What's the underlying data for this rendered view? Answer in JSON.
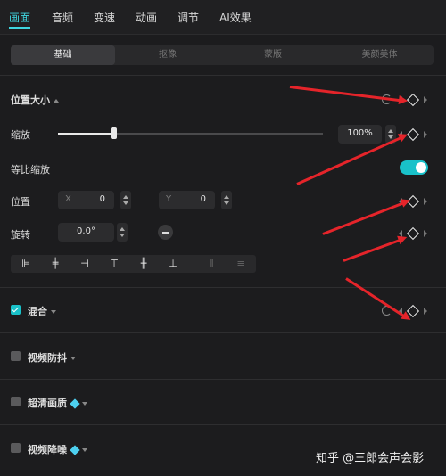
{
  "tabs": [
    "画面",
    "音频",
    "变速",
    "动画",
    "调节",
    "AI效果"
  ],
  "active_tab": 0,
  "sub_tabs": [
    "基础",
    "抠像",
    "蒙版",
    "美颜美体"
  ],
  "active_sub_tab": 0,
  "position_size": {
    "title": "位置大小",
    "scale_label": "缩放",
    "scale_value": "100%",
    "scale_level_percent": 21,
    "uniform_scale_label": "等比缩放",
    "uniform_scale_on": true,
    "position_label": "位置",
    "x_axis": "X",
    "x_value": "0",
    "y_axis": "Y",
    "y_value": "0",
    "rotate_label": "旋转",
    "rotate_value": "0.0°"
  },
  "align_icons": [
    "align-left-icon",
    "align-center-h-icon",
    "align-right-icon",
    "align-top-icon",
    "align-center-v-icon",
    "align-bottom-icon",
    "distribute-h-icon",
    "distribute-v-icon"
  ],
  "sections": {
    "blend": "混合",
    "stabilize": "视频防抖",
    "super_resolution": "超清画质",
    "denoise": "视频降噪"
  },
  "blend_checked": true,
  "watermark": "知乎 @三郎会声会影",
  "colors": {
    "accent": "#19c1c9",
    "arrow": "#e5242a",
    "tab_active": "#3fd6e0",
    "background": "#1c1c1e"
  }
}
